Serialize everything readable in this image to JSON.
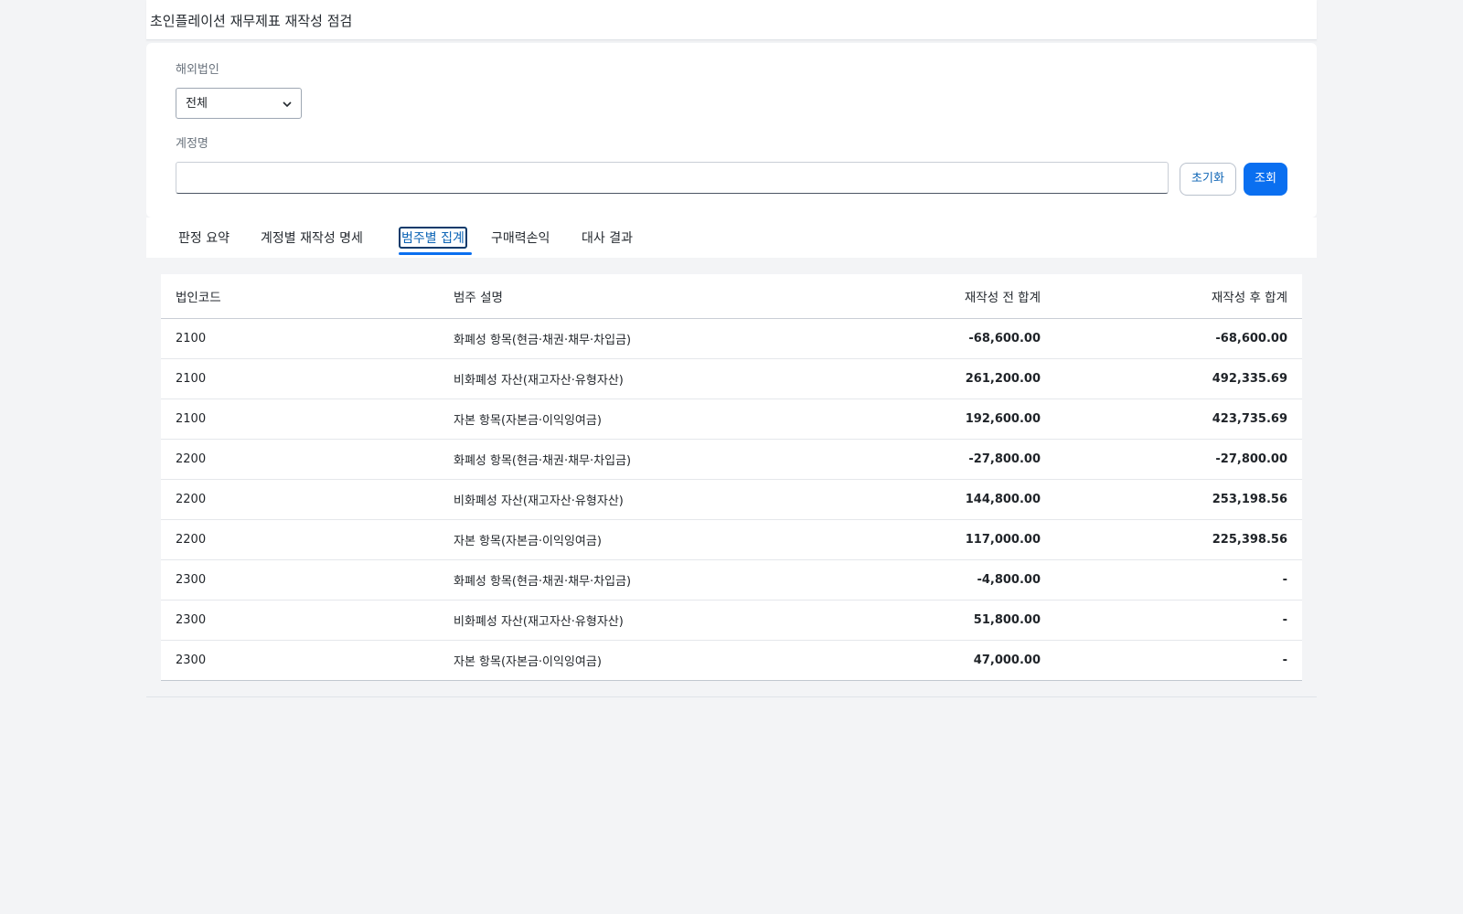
{
  "page": {
    "title": "초인플레이션 재무제표 재작성 점검"
  },
  "filters": {
    "entity_label": "해외법인",
    "entity_value": "전체",
    "account_label": "계정명",
    "account_value": "",
    "reset_label": "초기화",
    "search_label": "조회"
  },
  "tabs": [
    {
      "label": "판정 요약",
      "active": false
    },
    {
      "label": "계정별 재작성 명세",
      "active": false
    },
    {
      "label": "범주별 집계",
      "active": true
    },
    {
      "label": "구매력손익",
      "active": false
    },
    {
      "label": "대사 결과",
      "active": false
    }
  ],
  "table": {
    "headers": {
      "code": "법인코드",
      "desc": "범주 설명",
      "before": "재작성 전 합계",
      "after": "재작성 후 합계"
    },
    "rows": [
      {
        "code": "2100",
        "desc": "화폐성 항목(현금·채권·채무·차입금)",
        "before": "-68,600.00",
        "after": "-68,600.00"
      },
      {
        "code": "2100",
        "desc": "비화폐성 자산(재고자산·유형자산)",
        "before": "261,200.00",
        "after": "492,335.69"
      },
      {
        "code": "2100",
        "desc": "자본 항목(자본금·이익잉여금)",
        "before": "192,600.00",
        "after": "423,735.69"
      },
      {
        "code": "2200",
        "desc": "화폐성 항목(현금·채권·채무·차입금)",
        "before": "-27,800.00",
        "after": "-27,800.00"
      },
      {
        "code": "2200",
        "desc": "비화폐성 자산(재고자산·유형자산)",
        "before": "144,800.00",
        "after": "253,198.56"
      },
      {
        "code": "2200",
        "desc": "자본 항목(자본금·이익잉여금)",
        "before": "117,000.00",
        "after": "225,398.56"
      },
      {
        "code": "2300",
        "desc": "화폐성 항목(현금·채권·채무·차입금)",
        "before": "-4,800.00",
        "after": "-"
      },
      {
        "code": "2300",
        "desc": "비화폐성 자산(재고자산·유형자산)",
        "before": "51,800.00",
        "after": "-"
      },
      {
        "code": "2300",
        "desc": "자본 항목(자본금·이익잉여금)",
        "before": "47,000.00",
        "after": "-"
      }
    ]
  }
}
